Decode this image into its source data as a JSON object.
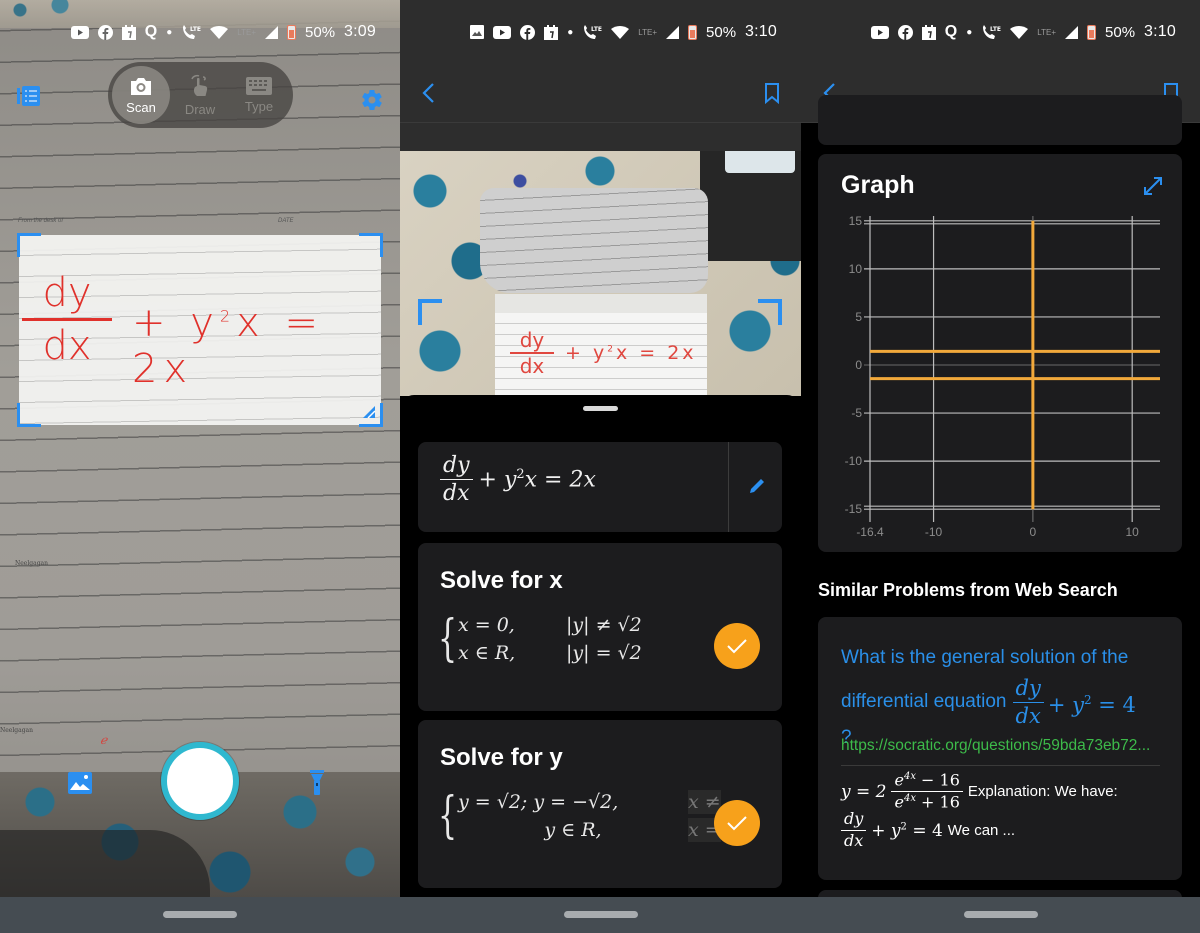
{
  "status_bars": [
    {
      "battery": "50%",
      "time": "3:09",
      "notification_icons": [
        "youtube-icon",
        "facebook-icon",
        "calendar-icon",
        "quora-icon"
      ],
      "network": [
        "call-lte-icon",
        "wifi-icon",
        "lte-plus-icon",
        "signal-icon",
        "battery-icon"
      ]
    },
    {
      "battery": "50%",
      "time": "3:10",
      "notification_icons": [
        "image-icon",
        "youtube-icon",
        "facebook-icon",
        "calendar-icon"
      ],
      "network": [
        "call-lte-icon",
        "wifi-icon",
        "lte-plus-icon",
        "signal-icon",
        "battery-icon"
      ]
    },
    {
      "battery": "50%",
      "time": "3:10",
      "notification_icons": [
        "youtube-icon",
        "facebook-icon",
        "calendar-icon",
        "quora-icon"
      ],
      "network": [
        "call-lte-icon",
        "wifi-icon",
        "lte-plus-icon",
        "signal-icon",
        "battery-icon"
      ]
    }
  ],
  "camera": {
    "modes": [
      {
        "label": "Scan",
        "icon": "camera-icon",
        "active": true
      },
      {
        "label": "Draw",
        "icon": "hand-draw-icon",
        "active": false
      },
      {
        "label": "Type",
        "icon": "keyboard-icon",
        "active": false
      }
    ],
    "paper_header_left": "From the desk of",
    "paper_header_right": "DATE",
    "paper_footer_name_1": "Neelgagan",
    "paper_footer_name_2": "Neelgagan",
    "handwritten": {
      "numerator": "dy",
      "denominator": "dx",
      "rest": "+ y",
      "exp": "2",
      "rest2": "x = 2x"
    },
    "accent_color": "#2b8ff0",
    "shutter_ring_color": "#2fb8cf"
  },
  "solution": {
    "equation": {
      "num": "dy",
      "den": "dx",
      "rest": "+ y",
      "exp": "2",
      "rest2": "x = 2x"
    },
    "solve_x": {
      "title": "Solve for x",
      "rows": [
        {
          "a": "x = 0,",
          "b": "|y| ≠ √2"
        },
        {
          "a": "x ∈ R,",
          "b": "|y| = √2"
        }
      ]
    },
    "solve_y": {
      "title": "Solve for y",
      "rows": [
        {
          "a": "y = √2;  y = −√2,",
          "b": "x ≠"
        },
        {
          "a": "y ∈ R,",
          "b": "x ="
        }
      ]
    },
    "check_color": "#f7a11b"
  },
  "graph": {
    "title": "Graph",
    "line_color": "#f2a93b"
  },
  "chart_data": {
    "type": "line",
    "title": "Graph",
    "xlabel": "",
    "ylabel": "",
    "xlim": [
      -16.4,
      12.8
    ],
    "ylim": [
      -15.5,
      15.5
    ],
    "x_ticks": [
      {
        "v": -16.4,
        "label": "-16.4"
      },
      {
        "v": -10,
        "label": "-10"
      },
      {
        "v": 0,
        "label": "0"
      },
      {
        "v": 10,
        "label": "10"
      }
    ],
    "y_ticks": [
      {
        "v": 15,
        "label": "15"
      },
      {
        "v": 10,
        "label": "10"
      },
      {
        "v": 5,
        "label": "5"
      },
      {
        "v": 0,
        "label": "0"
      },
      {
        "v": -5,
        "label": "-5"
      },
      {
        "v": -10,
        "label": "-10"
      },
      {
        "v": -15,
        "label": "-15"
      }
    ],
    "grid": true,
    "series": [
      {
        "name": "y = √2",
        "kind": "horizontal",
        "value": 1.414
      },
      {
        "name": "y = −√2",
        "kind": "horizontal",
        "value": -1.414
      },
      {
        "name": "x = 0",
        "kind": "vertical",
        "value": 0,
        "y_range": [
          -15,
          15
        ]
      }
    ]
  },
  "similar": {
    "heading": "Similar Problems from Web Search",
    "results": [
      {
        "question_pre": "What is the general solution of the",
        "question_mid": "differential equation",
        "question_math": {
          "num": "dy",
          "den": "dx",
          "rest": "+ y",
          "exp": "2",
          "rest2": " = 4"
        },
        "question_end": "?",
        "url": "https://socratic.org/questions/59bda73eb72...",
        "answer_math": {
          "lhs": "y = 2",
          "num": "e",
          "num_exp": "4x",
          "num_rest": " − 16",
          "den": "e",
          "den_exp": "4x",
          "den_rest": " + 16"
        },
        "answer_text_1": "Explanation: We have:",
        "answer_math_2": {
          "num": "dy",
          "den": "dx",
          "rest": "+ y",
          "exp": "2",
          "rest2": " = 4"
        },
        "answer_text_2": "We can ..."
      }
    ]
  }
}
